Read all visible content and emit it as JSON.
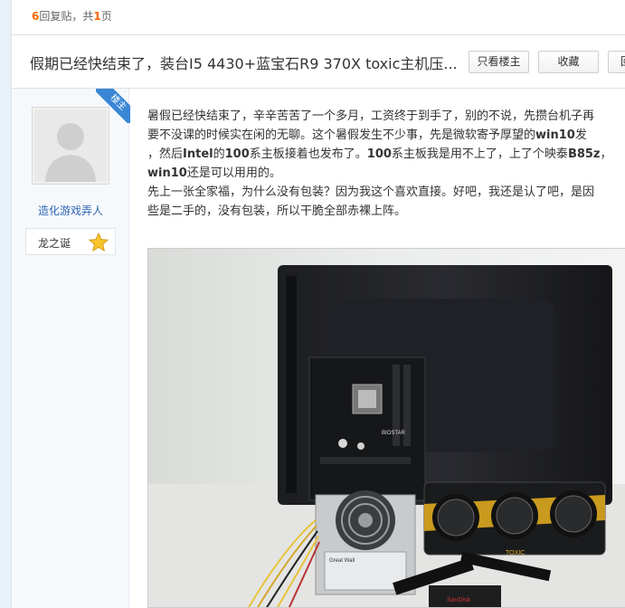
{
  "reply_bar": {
    "count": "6",
    "text_before": "回复贴，共",
    "pages": "1",
    "text_after": "页"
  },
  "thread": {
    "title": "假期已经快结束了，装台I5 4430+蓝宝石R9 370X toxic主机压...",
    "buttons": {
      "only_op": "只看楼主",
      "favorite": "收藏",
      "more": "回"
    }
  },
  "author": {
    "badge": "楼主",
    "name": "造化游戏弄人",
    "level": "龙之诞"
  },
  "post": {
    "p1_l1": "暑假已经快结束了，辛辛苦苦了一个多月，工资终于到手了，别的不说，先攒台机子再",
    "p1_l2a": "要不没课的时候实在闲的无聊。这个暑假发生不少事，先是微软寄予厚望的",
    "p1_l2b": "win10",
    "p1_l2c": "发",
    "p1_l3a": "，然后",
    "p1_l3b": "Intel",
    "p1_l3c": "的",
    "p1_l3d": "100",
    "p1_l3e": "系主板接着也发布了。",
    "p1_l3f": "100",
    "p1_l3g": "系主板我是用不上了，上了个映泰",
    "p1_l3h": "B85z",
    "p1_l3i": "，",
    "p1_l4a": "win10",
    "p1_l4b": "还是可以用用的。",
    "p2_l1": "先上一张全家福，为什么没有包装？因为我这个喜欢直接。好吧，我还是认了吧，是因",
    "p2_l2": "些是二手的，没有包装，所以干脆全部赤裸上阵。"
  },
  "photo": {
    "description": "pc-components-family-photo",
    "psu_label": "Great Wall",
    "board_label": "BIOSTAR",
    "gpu_label": "TOXIC",
    "ssd_label": "SanDisk"
  },
  "colors": {
    "accent_orange": "#ff6600",
    "link_blue": "#2d64b3",
    "badge_blue": "#3a86d6"
  }
}
